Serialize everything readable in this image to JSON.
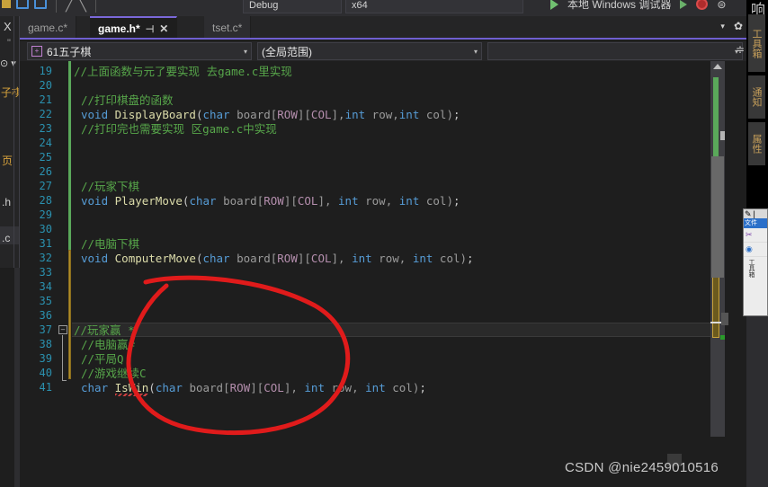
{
  "toolbar": {
    "config_dropdown": "Debug",
    "platform_dropdown": "x64",
    "run_label": "本地 Windows 调试器",
    "icons": [
      "save-all-icon",
      "undo-icon",
      "redo-icon",
      "start-debug-icon",
      "stop-debug-icon",
      "overflow-icon"
    ]
  },
  "left_panel": {
    "close_label": "X",
    "quote_label": "\"",
    "dropdown_label": "⊙ ▾",
    "items": [
      "子棋",
      "页",
      ".h",
      ".c"
    ]
  },
  "tabs": [
    {
      "label": "game.c*",
      "active": false
    },
    {
      "label": "game.h*",
      "active": true,
      "pin": "⊣",
      "close": "✕"
    },
    {
      "label": "tset.c*",
      "active": false
    }
  ],
  "tabbar": {
    "chevron": "▾",
    "gear": "✿"
  },
  "navbar": {
    "scope": "61五子棋",
    "scope_icon": "project-icon",
    "global": "(全局范围)",
    "third": "",
    "arrow": "▾",
    "right_button": "≑"
  },
  "editor": {
    "lines": [
      {
        "num": 19,
        "indent": 0,
        "segments": [
          {
            "t": "//上面函数与元了要实现 去game.c里实现",
            "c": "cmt"
          }
        ]
      },
      {
        "num": 20,
        "indent": 0,
        "segments": []
      },
      {
        "num": 21,
        "indent": 1,
        "segments": [
          {
            "t": "//打印棋盘的函数",
            "c": "cmt"
          }
        ]
      },
      {
        "num": 22,
        "indent": 1,
        "segments": [
          {
            "t": "void ",
            "c": "kw"
          },
          {
            "t": "DisplayBoard",
            "c": "fn"
          },
          {
            "t": "(",
            "c": "pun"
          },
          {
            "t": "char",
            "c": "kw"
          },
          {
            "t": " board[",
            "c": "id"
          },
          {
            "t": "ROW",
            "c": "mac"
          },
          {
            "t": "][",
            "c": "id"
          },
          {
            "t": "COL",
            "c": "mac"
          },
          {
            "t": "],",
            "c": "id"
          },
          {
            "t": "int",
            "c": "kw"
          },
          {
            "t": " row,",
            "c": "id"
          },
          {
            "t": "int",
            "c": "kw"
          },
          {
            "t": " col)",
            "c": "id"
          },
          {
            "t": ";",
            "c": "pun"
          }
        ]
      },
      {
        "num": 23,
        "indent": 1,
        "segments": [
          {
            "t": "//打印完也需要实现 区game.c中实现",
            "c": "cmt"
          }
        ]
      },
      {
        "num": 24,
        "indent": 0,
        "segments": []
      },
      {
        "num": 25,
        "indent": 0,
        "segments": []
      },
      {
        "num": 26,
        "indent": 0,
        "segments": []
      },
      {
        "num": 27,
        "indent": 1,
        "segments": [
          {
            "t": "//玩家下棋",
            "c": "cmt"
          }
        ]
      },
      {
        "num": 28,
        "indent": 1,
        "segments": [
          {
            "t": "void ",
            "c": "kw"
          },
          {
            "t": "PlayerMove",
            "c": "fn"
          },
          {
            "t": "(",
            "c": "pun"
          },
          {
            "t": "char",
            "c": "kw"
          },
          {
            "t": " board[",
            "c": "id"
          },
          {
            "t": "ROW",
            "c": "mac"
          },
          {
            "t": "][",
            "c": "id"
          },
          {
            "t": "COL",
            "c": "mac"
          },
          {
            "t": "], ",
            "c": "id"
          },
          {
            "t": "int",
            "c": "kw"
          },
          {
            "t": " row, ",
            "c": "id"
          },
          {
            "t": "int",
            "c": "kw"
          },
          {
            "t": " col)",
            "c": "id"
          },
          {
            "t": ";",
            "c": "pun"
          }
        ]
      },
      {
        "num": 29,
        "indent": 0,
        "segments": []
      },
      {
        "num": 30,
        "indent": 0,
        "segments": []
      },
      {
        "num": 31,
        "indent": 1,
        "segments": [
          {
            "t": "//电脑下棋",
            "c": "cmt"
          }
        ]
      },
      {
        "num": 32,
        "indent": 1,
        "segments": [
          {
            "t": "void ",
            "c": "kw"
          },
          {
            "t": "ComputerMove",
            "c": "fn"
          },
          {
            "t": "(",
            "c": "pun"
          },
          {
            "t": "char",
            "c": "kw"
          },
          {
            "t": " board[",
            "c": "id"
          },
          {
            "t": "ROW",
            "c": "mac"
          },
          {
            "t": "][",
            "c": "id"
          },
          {
            "t": "COL",
            "c": "mac"
          },
          {
            "t": "], ",
            "c": "id"
          },
          {
            "t": "int",
            "c": "kw"
          },
          {
            "t": " row, ",
            "c": "id"
          },
          {
            "t": "int",
            "c": "kw"
          },
          {
            "t": " col)",
            "c": "id"
          },
          {
            "t": ";",
            "c": "pun"
          }
        ]
      },
      {
        "num": 33,
        "indent": 0,
        "segments": []
      },
      {
        "num": 34,
        "indent": 0,
        "segments": []
      },
      {
        "num": 35,
        "indent": 0,
        "segments": []
      },
      {
        "num": 36,
        "indent": 0,
        "segments": []
      },
      {
        "num": 37,
        "indent": 0,
        "segments": [
          {
            "t": "//玩家赢 *",
            "c": "cmt"
          }
        ]
      },
      {
        "num": 38,
        "indent": 1,
        "segments": [
          {
            "t": "//电脑赢#",
            "c": "cmt"
          }
        ]
      },
      {
        "num": 39,
        "indent": 1,
        "segments": [
          {
            "t": "//平局Q",
            "c": "cmt"
          }
        ]
      },
      {
        "num": 40,
        "indent": 1,
        "segments": [
          {
            "t": "//游戏继续C",
            "c": "cmt"
          }
        ]
      },
      {
        "num": 41,
        "indent": 1,
        "segments": [
          {
            "t": "char ",
            "c": "kw"
          },
          {
            "t": "IsWin",
            "c": "fn"
          },
          {
            "t": "(",
            "c": "pun"
          },
          {
            "t": "char",
            "c": "kw"
          },
          {
            "t": " board[",
            "c": "id"
          },
          {
            "t": "ROW",
            "c": "mac"
          },
          {
            "t": "][",
            "c": "id"
          },
          {
            "t": "COL",
            "c": "mac"
          },
          {
            "t": "], ",
            "c": "id"
          },
          {
            "t": "int",
            "c": "kw"
          },
          {
            "t": " row, ",
            "c": "id"
          },
          {
            "t": "int",
            "c": "kw"
          },
          {
            "t": " col)",
            "c": "id"
          },
          {
            "t": ";",
            "c": "pun"
          }
        ]
      }
    ],
    "fold_marker": "⊟",
    "highlighted_line": 37,
    "error_token": "IsWin"
  },
  "right_dock": {
    "tabs": [
      "工具箱",
      "通知",
      "属性"
    ],
    "clipped_char": "响"
  },
  "mini_window": {
    "menu": "文件",
    "vertical_label": "工具箱"
  },
  "annotation": {
    "shape": "ellipse",
    "color": "#e01b1b",
    "target_lines": "37-41"
  },
  "watermark": {
    "text": "CSDN @nie2459010516"
  },
  "colors": {
    "editor_bg": "#1e1e1e",
    "chrome_bg": "#2d2d30",
    "panel_bg": "#252526",
    "accent": "#6f5fd0",
    "comment": "#57a64a",
    "keyword": "#569cd6",
    "function": "#dcdcaa",
    "macro": "#b48ead",
    "linenum": "#2b91af",
    "change_added": "#5aa85a",
    "change_unsaved": "#c8a23c",
    "annotation_red": "#e01b1b"
  }
}
